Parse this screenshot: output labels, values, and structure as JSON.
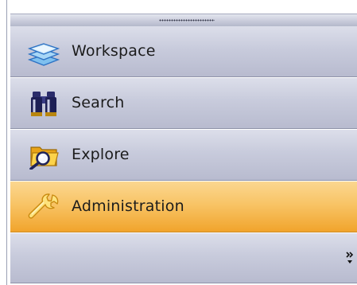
{
  "nav_pane": {
    "items": [
      {
        "label": "Workspace",
        "icon": "stacked-layers-icon",
        "selected": false
      },
      {
        "label": "Search",
        "icon": "binoculars-icon",
        "selected": false
      },
      {
        "label": "Explore",
        "icon": "folder-magnifier-icon",
        "selected": false
      },
      {
        "label": "Administration",
        "icon": "wrench-icon",
        "selected": true
      }
    ],
    "overflow_icon": "chevron-double-down-icon"
  },
  "colors": {
    "item_background": "#c8cbdc",
    "selected_background": "#f8c466",
    "item_border": "#8f93a9"
  }
}
